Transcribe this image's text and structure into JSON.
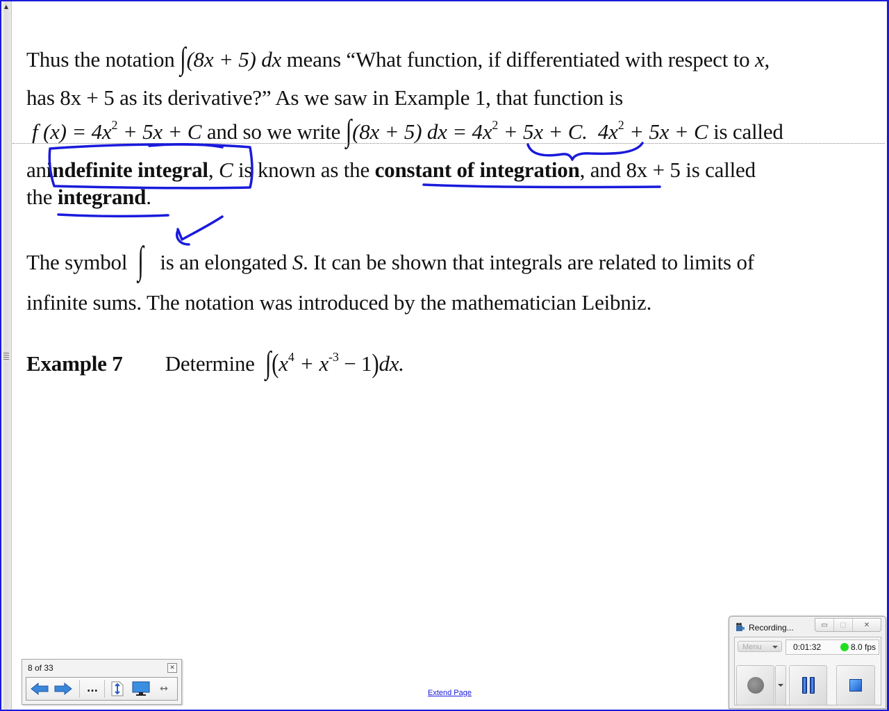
{
  "document": {
    "para1": {
      "line1_a": "Thus the notation",
      "line1_integrand": "(8x + 5) dx",
      "line1_b": "means “What function, if differentiated with respect to",
      "line1_x": "x",
      "line1_c": ",",
      "line2": "has 8x + 5 as its derivative?”  As we saw in Example 1, that function is",
      "line3_f": "f (x) = 4x",
      "line3_f_rest": " + 5x + C",
      "line3_mid": "and so we write",
      "line3_int": "(8x + 5) dx = 4x",
      "line3_int_rest": " + 5x + C.",
      "line3_expr": "4x",
      "line3_expr_rest": " + 5x + C",
      "line3_end": "is called",
      "line4_a": "an",
      "line4_term1": "indefinite integral",
      "line4_b": ",",
      "line4_C": "C",
      "line4_c": "is known as the",
      "line4_term2": "constant of integration",
      "line4_d": ", and 8x + 5 is called",
      "line5_a": "the",
      "line5_term3": "integrand",
      "line5_b": ".",
      "exp2": "2"
    },
    "para2": {
      "line1_a": "The symbol",
      "line1_b": "is an elongated",
      "line1_S": "S",
      "line1_c": ".  It can be shown that integrals are related to limits of",
      "line2": "infinite sums.  The notation was introduced by the mathematician Leibniz."
    },
    "example": {
      "label": "Example 7",
      "text": "Determine",
      "expr_x1": "x",
      "exp1": "4",
      "expr_mid": " + x",
      "exp2": "-3",
      "expr_end": " − 1",
      "dx": "dx."
    },
    "integral_symbol": "∫"
  },
  "page_navigator": {
    "page_indicator": "8 of 33",
    "close_icon": "close-icon",
    "buttons": [
      "previous-page",
      "next-page",
      "more-options",
      "fit-page",
      "display-settings",
      "fit-width"
    ],
    "more_label": "..."
  },
  "extend_page_link": "Extend Page",
  "recorder": {
    "title": "Recording...",
    "menu_label": "Menu",
    "elapsed_time": "0:01:32",
    "fps": "8.0 fps",
    "status_color": "#22dd22"
  },
  "ink_color": "#1a1adc"
}
